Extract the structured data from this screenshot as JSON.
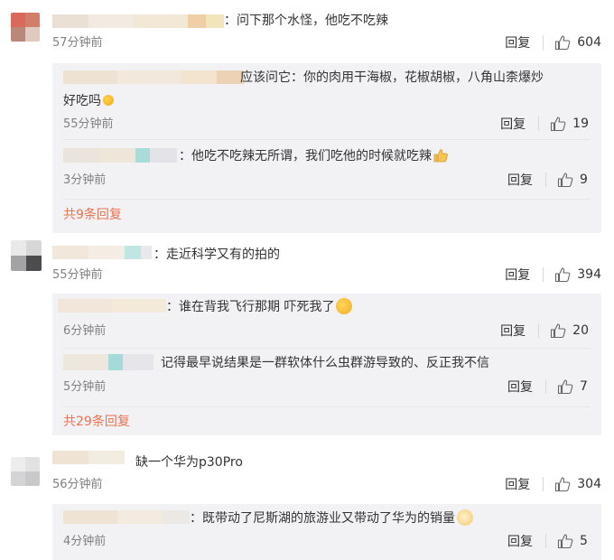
{
  "threads": [
    {
      "comment": "：问下那个水怪，他吃不吃辣",
      "time": "57分钟前",
      "reply_label": "回复",
      "likes": "604",
      "replies": [
        {
          "text": "应该问它：你的肉用干海椒，花椒胡椒，八角山柰爆炒",
          "text2": "好吃吗",
          "time": "55分钟前",
          "reply_label": "回复",
          "likes": "19"
        },
        {
          "text": "：他吃不吃辣无所谓，我们吃他的时候就吃辣",
          "time": "3分钟前",
          "reply_label": "回复",
          "likes": "9"
        }
      ],
      "more": "共9条回复"
    },
    {
      "comment": "：走近科学又有的拍的",
      "time": "55分钟前",
      "reply_label": "回复",
      "likes": "394",
      "replies": [
        {
          "text": "：谁在背我飞行那期  吓死我了",
          "time": "6分钟前",
          "reply_label": "回复",
          "likes": "20"
        },
        {
          "text": "记得最早说结果是一群软体什么虫群游导致的、反正我不信",
          "time": "5分钟前",
          "reply_label": "回复",
          "likes": "7"
        }
      ],
      "more": "共29条回复"
    },
    {
      "comment": "缺一个华为p30Pro",
      "time": "56分钟前",
      "reply_label": "回复",
      "likes": "304",
      "replies": [
        {
          "text": "：既带动了尼斯湖的旅游业又带动了华为的销量",
          "time": "4分钟前",
          "reply_label": "回复",
          "likes": "5"
        }
      ]
    }
  ],
  "icons": {
    "like": "thumbs-up-icon",
    "smile": "wink-emoji-icon",
    "sad": "sad-emoji-icon",
    "thumb": "thumbs-up-emoji-icon",
    "cat": "cat-emoji-icon"
  },
  "colors": {
    "accent": "#eb7350",
    "reply_bg": "#f2f2f5",
    "time": "#808080"
  }
}
